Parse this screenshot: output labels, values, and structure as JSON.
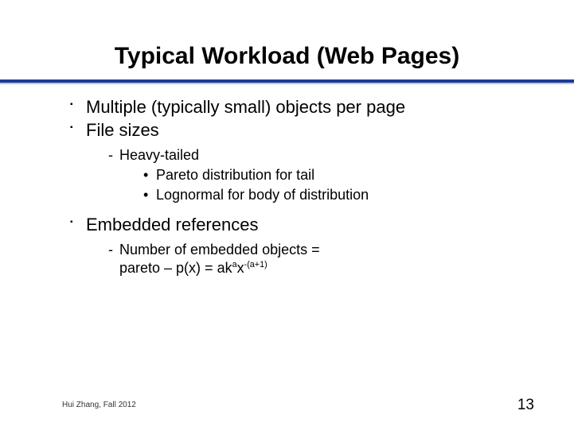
{
  "title": "Typical Workload (Web Pages)",
  "bullets": {
    "b1": "Multiple (typically small) objects per page",
    "b2": "File sizes",
    "b2s1": "Heavy-tailed",
    "b2s1a": "Pareto distribution for tail",
    "b2s1b": "Lognormal for body of distribution",
    "b3": "Embedded references",
    "b3s1_line1": "Number of embedded objects =",
    "b3s1_line2_pre": "pareto – p(x) = ak",
    "b3s1_line2_sup1": "a",
    "b3s1_line2_mid": "x",
    "b3s1_line2_sup2": "-(a+1)"
  },
  "footer": {
    "left": "Hui Zhang, Fall 2012",
    "right": "13"
  }
}
